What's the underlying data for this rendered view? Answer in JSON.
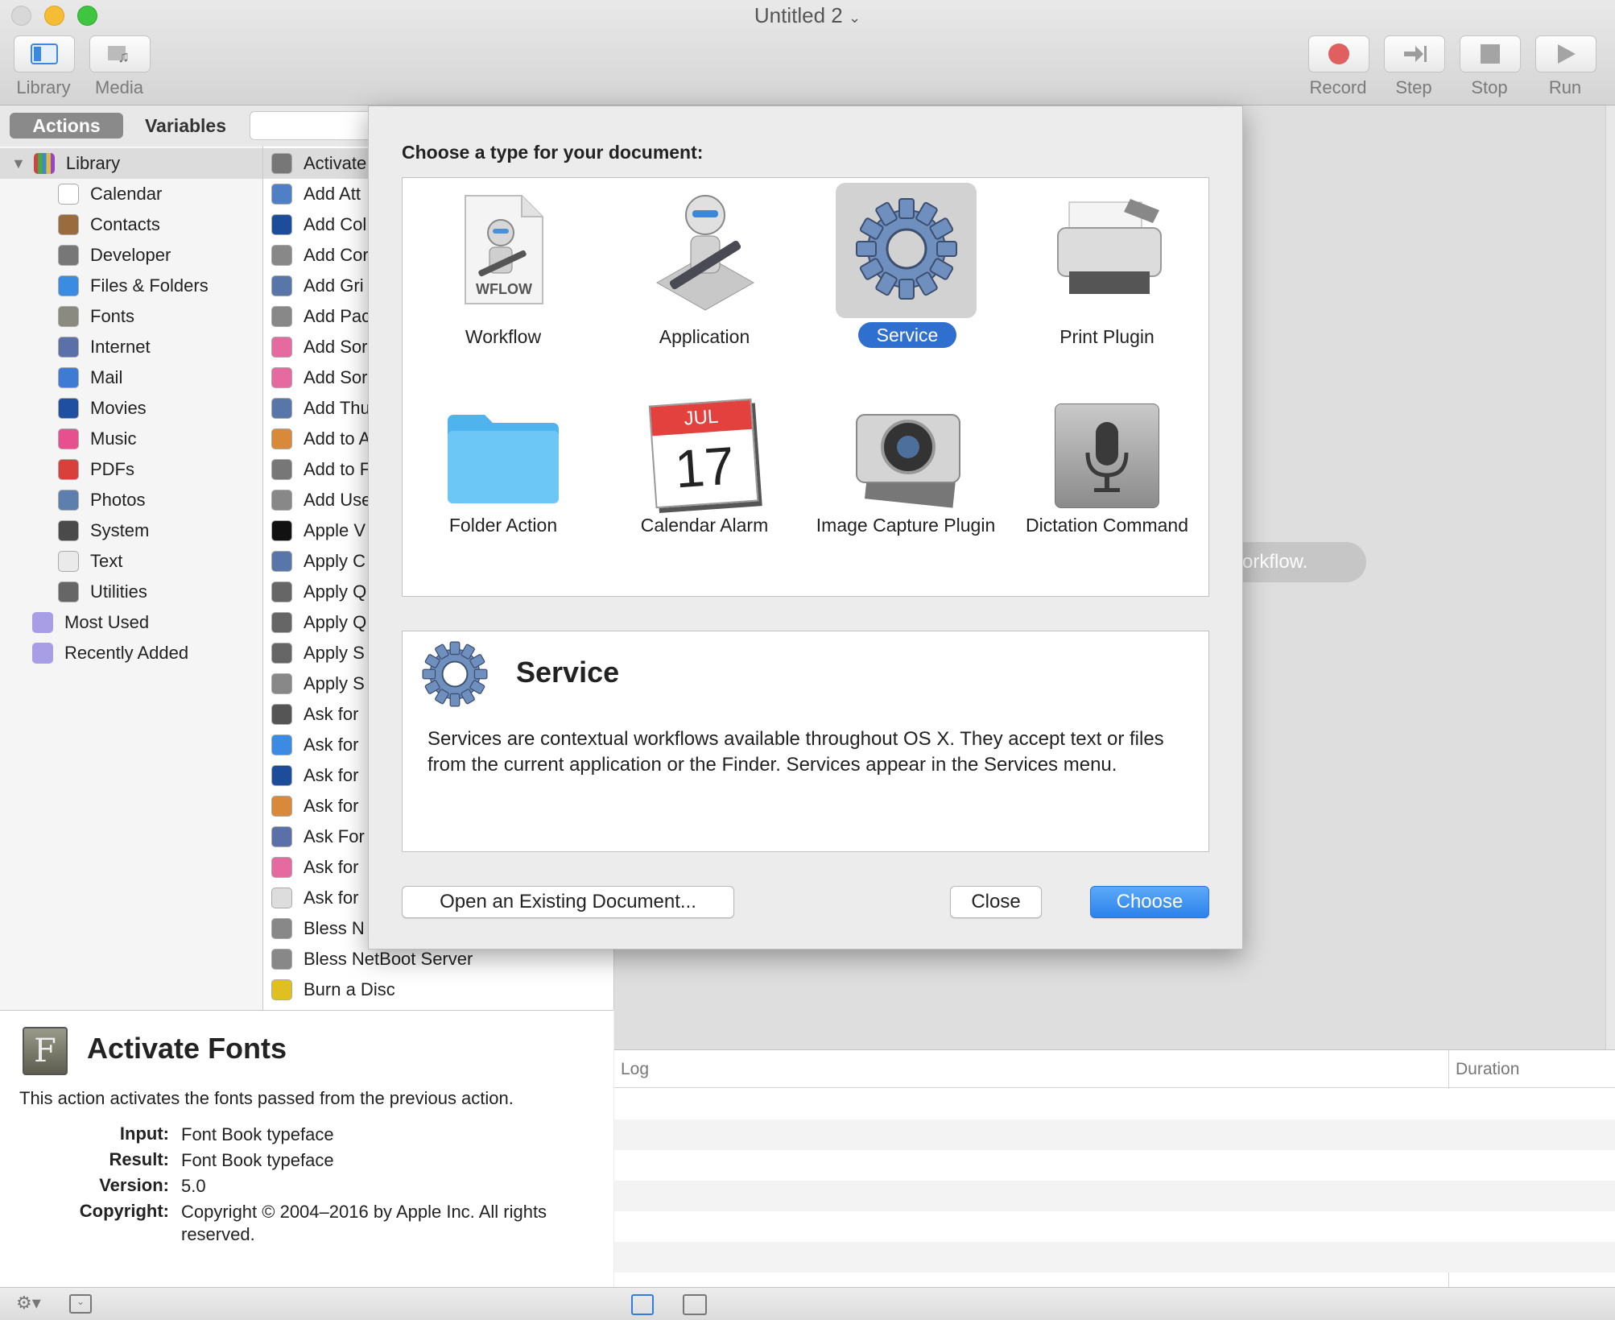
{
  "window": {
    "title": "Untitled 2"
  },
  "toolbar": {
    "left": [
      {
        "label": "Library",
        "icon": "library-icon"
      },
      {
        "label": "Media",
        "icon": "media-icon"
      }
    ],
    "right": [
      {
        "label": "Record",
        "icon": "record-icon"
      },
      {
        "label": "Step",
        "icon": "step-icon"
      },
      {
        "label": "Stop",
        "icon": "stop-icon"
      },
      {
        "label": "Run",
        "icon": "run-icon"
      }
    ]
  },
  "segments": {
    "actions": "Actions",
    "variables": "Variables"
  },
  "library": {
    "root": "Library",
    "items": [
      "Calendar",
      "Contacts",
      "Developer",
      "Files & Folders",
      "Fonts",
      "Internet",
      "Mail",
      "Movies",
      "Music",
      "PDFs",
      "Photos",
      "System",
      "Text",
      "Utilities"
    ],
    "smart": [
      "Most Used",
      "Recently Added"
    ]
  },
  "actions": [
    "Activate",
    "Add Att",
    "Add Col",
    "Add Cor",
    "Add Gri",
    "Add Pac",
    "Add Sor",
    "Add Sor",
    "Add Thu",
    "Add to A",
    "Add to F",
    "Add Use",
    "Apple V",
    "Apply C",
    "Apply Q",
    "Apply Q",
    "Apply S",
    "Apply S",
    "Ask for",
    "Ask for",
    "Ask for",
    "Ask for",
    "Ask For",
    "Ask for",
    "Ask for",
    "Bless N",
    "Bless NetBoot Server",
    "Burn a Disc"
  ],
  "description": {
    "title": "Activate Fonts",
    "text": "This action activates the fonts passed from the previous action.",
    "fields": [
      {
        "label": "Input:",
        "value": "Font Book typeface"
      },
      {
        "label": "Result:",
        "value": "Font Book typeface"
      },
      {
        "label": "Version:",
        "value": "5.0"
      },
      {
        "label": "Copyright:",
        "value": "Copyright © 2004–2016 by Apple Inc. All rights reserved."
      }
    ]
  },
  "canvas": {
    "hint": "r workflow."
  },
  "log": {
    "col_log": "Log",
    "col_duration": "Duration"
  },
  "sheet": {
    "prompt": "Choose a type for your document:",
    "types": [
      {
        "label": "Workflow",
        "selected": false
      },
      {
        "label": "Application",
        "selected": false
      },
      {
        "label": "Service",
        "selected": true
      },
      {
        "label": "Print Plugin",
        "selected": false
      },
      {
        "label": "Folder Action",
        "selected": false
      },
      {
        "label": "Calendar Alarm",
        "selected": false
      },
      {
        "label": "Image Capture Plugin",
        "selected": false
      },
      {
        "label": "Dictation Command",
        "selected": false
      }
    ],
    "wflow_badge": "WFLOW",
    "calendar_month": "JUL",
    "calendar_day": "17",
    "info_title": "Service",
    "info_text": "Services are contextual workflows available throughout OS X. They accept text or files from the current application or the Finder. Services appear in the Services menu.",
    "open_button": "Open an Existing Document...",
    "close_button": "Close",
    "choose_button": "Choose"
  },
  "colors": {
    "accent": "#2f7de1",
    "selected_tile": "#d2d2d2"
  }
}
